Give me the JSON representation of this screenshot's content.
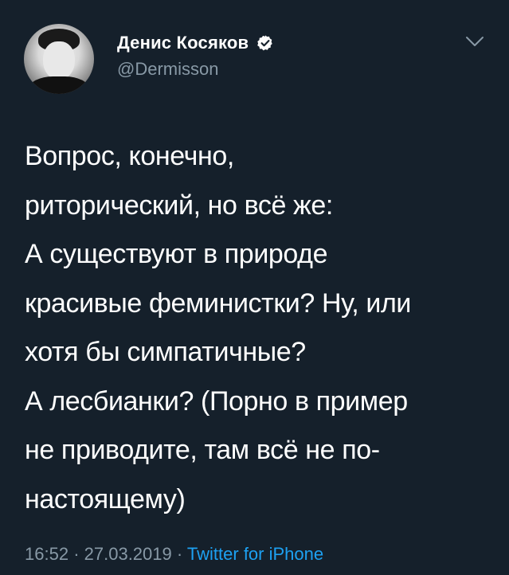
{
  "author": {
    "display_name": "Денис Косяков",
    "handle": "@Dermisson",
    "verified": true,
    "avatar_icon": "user-avatar-photo"
  },
  "tweet": {
    "lines": [
      "Вопрос, конечно,",
      "риторический, но всё же:",
      "А существуют в природе",
      "красивые феминистки? Ну, или",
      "хотя бы симпатичные?",
      "А лесбианки? (Порно в пример",
      "не приводите, там всё не по-",
      "настоящему)"
    ]
  },
  "meta": {
    "time": "16:52",
    "separator": "·",
    "date": "27.03.2019",
    "source": "Twitter for iPhone"
  },
  "icons": {
    "verified": "verified-badge-icon",
    "menu": "chevron-down-icon"
  },
  "colors": {
    "background": "#15202b",
    "text": "#ffffff",
    "secondary": "#8899a6",
    "link": "#1da1f2"
  }
}
